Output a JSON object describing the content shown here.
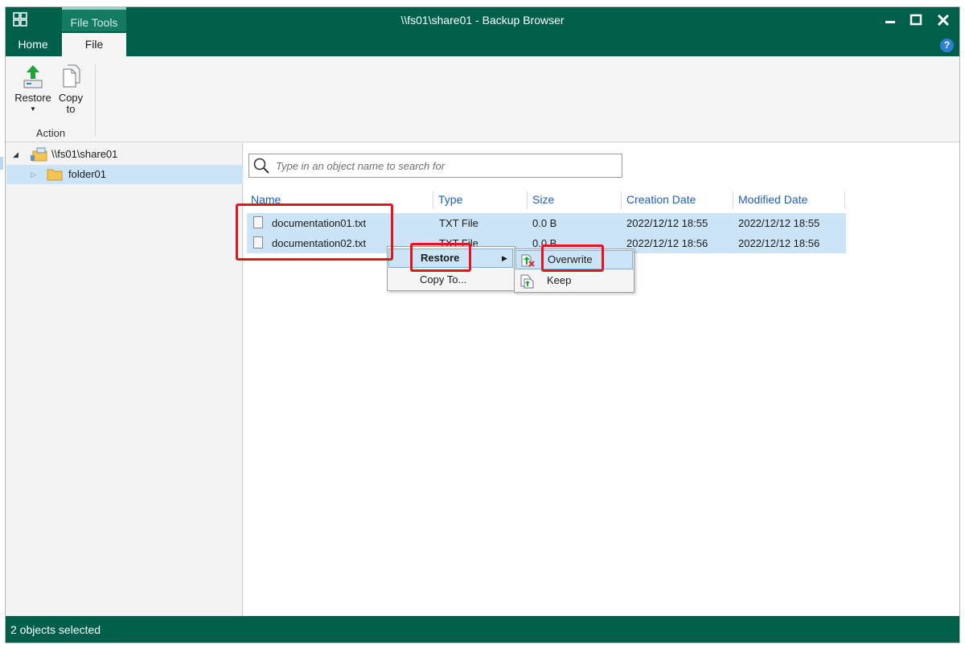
{
  "window": {
    "title": "\\\\fs01\\share01 - Backup Browser",
    "context_tab_group": "File Tools"
  },
  "tabs": [
    {
      "label": "Home"
    },
    {
      "label": "File"
    }
  ],
  "ribbon": {
    "restore_label": "Restore",
    "copy_label_line1": "Copy",
    "copy_label_line2": "to",
    "group_label": "Action"
  },
  "tree": {
    "root": "\\\\fs01\\share01",
    "folder": "folder01"
  },
  "search": {
    "placeholder": "Type in an object name to search for"
  },
  "table": {
    "columns": [
      "Name",
      "Type",
      "Size",
      "Creation Date",
      "Modified Date"
    ],
    "rows": [
      {
        "name": "documentation01.txt",
        "type": "TXT File",
        "size": "0.0 B",
        "created": "2022/12/12 18:55",
        "modified": "2022/12/12 18:55"
      },
      {
        "name": "documentation02.txt",
        "type": "TXT File",
        "size": "0.0 B",
        "created": "2022/12/12 18:56",
        "modified": "2022/12/12 18:56"
      }
    ]
  },
  "context_menu": {
    "restore": "Restore",
    "copy_to": "Copy To..."
  },
  "submenu": {
    "overwrite": "Overwrite",
    "keep": "Keep"
  },
  "status": {
    "text": "2 objects selected"
  },
  "colors": {
    "brand": "#005f4b",
    "selection": "#cce4f7",
    "annotation": "#e8141b",
    "header_text": "#1e5fb4"
  }
}
